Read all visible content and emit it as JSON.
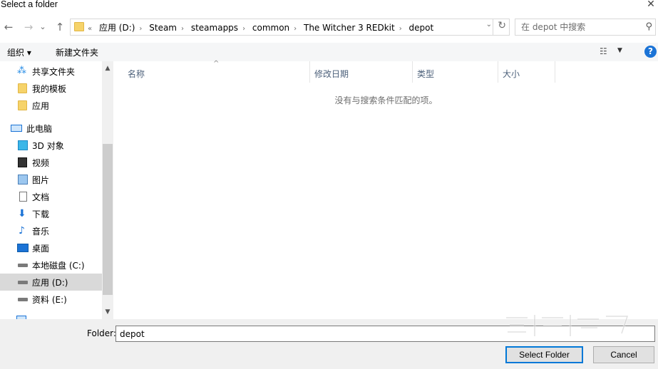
{
  "window": {
    "title": "Select a folder",
    "close_glyph": "✕"
  },
  "nav": {
    "back": "←",
    "forward": "→",
    "recent": "⌄",
    "up": "↑",
    "overflow": "«",
    "breadcrumb": [
      "应用 (D:)",
      "Steam",
      "steamapps",
      "common",
      "The Witcher 3 REDkit",
      "depot"
    ],
    "refresh": "↻",
    "dropdown": "⌄"
  },
  "search": {
    "placeholder": "在 depot 中搜索",
    "icon": "search-icon"
  },
  "toolbar": {
    "organize": "组织 ▾",
    "new_folder": "新建文件夹",
    "view_icon": "☷",
    "view_dd": "▼",
    "help": "?"
  },
  "sidebar": {
    "items": [
      {
        "label": "共享文件夹",
        "icon": "share-icon"
      },
      {
        "label": "我的模板",
        "icon": "folder-icon"
      },
      {
        "label": "应用",
        "icon": "folder-icon"
      },
      {
        "label": "此电脑",
        "icon": "computer-icon"
      },
      {
        "label": "3D 对象",
        "icon": "3d-objects-icon"
      },
      {
        "label": "视频",
        "icon": "video-icon"
      },
      {
        "label": "图片",
        "icon": "pictures-icon"
      },
      {
        "label": "文档",
        "icon": "documents-icon"
      },
      {
        "label": "下载",
        "icon": "downloads-icon"
      },
      {
        "label": "音乐",
        "icon": "music-icon"
      },
      {
        "label": "桌面",
        "icon": "desktop-icon"
      },
      {
        "label": "本地磁盘 (C:)",
        "icon": "drive-icon"
      },
      {
        "label": "应用 (D:)",
        "icon": "drive-icon",
        "selected": true
      },
      {
        "label": "资料 (E:)",
        "icon": "drive-icon"
      }
    ],
    "scroll_up": "▲",
    "scroll_down": "▼"
  },
  "columns": [
    "名称",
    "修改日期",
    "类型",
    "大小"
  ],
  "sort_caret": "^",
  "empty_message": "没有与搜索条件匹配的项。",
  "footer": {
    "folder_label": "Folder:",
    "folder_value": "depot",
    "select_button": "Select Folder",
    "cancel_button": "Cancel"
  },
  "colors": {
    "accent": "#0078d7",
    "selection": "#d9d9d9",
    "help": "#1b73d6"
  }
}
